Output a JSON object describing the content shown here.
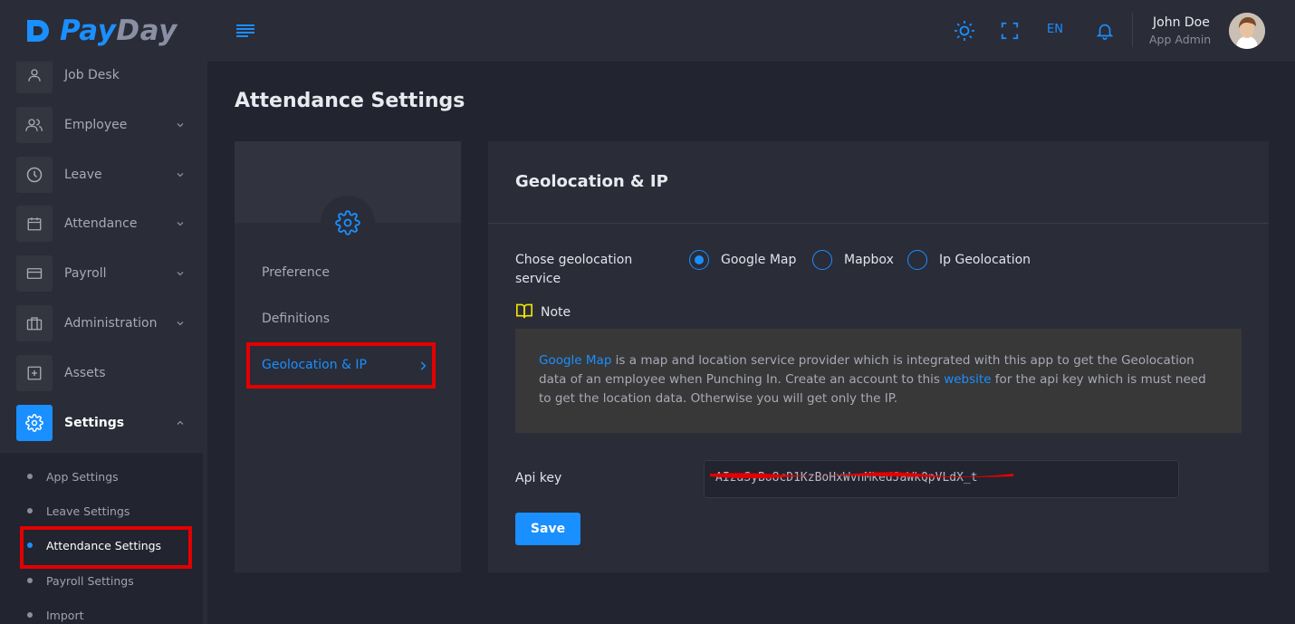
{
  "brand": {
    "part1": "Pay",
    "part2": "Day"
  },
  "header": {
    "language": "EN",
    "user_name": "John Doe",
    "user_role": "App Admin"
  },
  "sidebar": {
    "items": [
      {
        "label": "Job Desk",
        "icon": "user-icon"
      },
      {
        "label": "Employee",
        "icon": "users-icon"
      },
      {
        "label": "Leave",
        "icon": "clock-icon"
      },
      {
        "label": "Attendance",
        "icon": "calendar-icon"
      },
      {
        "label": "Payroll",
        "icon": "credit-card-icon"
      },
      {
        "label": "Administration",
        "icon": "briefcase-icon"
      },
      {
        "label": "Assets",
        "icon": "plus-square-icon"
      },
      {
        "label": "Settings",
        "icon": "gear-icon"
      }
    ],
    "submenu": [
      {
        "label": "App Settings"
      },
      {
        "label": "Leave Settings"
      },
      {
        "label": "Attendance Settings"
      },
      {
        "label": "Payroll Settings"
      },
      {
        "label": "Import"
      }
    ]
  },
  "page": {
    "title": "Attendance Settings",
    "tabs": [
      {
        "label": "Preference"
      },
      {
        "label": "Definitions"
      },
      {
        "label": "Geolocation & IP"
      }
    ],
    "section_title": "Geolocation & IP",
    "geo_label": "Chose geolocation service",
    "geo_options": [
      {
        "label": "Google Map",
        "checked": true
      },
      {
        "label": "Mapbox",
        "checked": false
      },
      {
        "label": "Ip Geolocation",
        "checked": false
      }
    ],
    "note_label": "Note",
    "note": {
      "link1": "Google Map",
      "text1": " is a map and location service provider which is integrated with this app to get the Geolocation data of an employee when Punching In. Create an account to this ",
      "link2": "website",
      "text2": " for the api key which is must need to get the location data. Otherwise you will get only the IP."
    },
    "api_label": "Api key",
    "api_value": "AIzaSyBo8cD1KzBoHxWvnMkedJaWkQpVLdX_t",
    "save_label": "Save"
  },
  "colors": {
    "accent": "#1a8fff",
    "highlight_box": "#e30000",
    "note_icon": "#f2e600"
  }
}
